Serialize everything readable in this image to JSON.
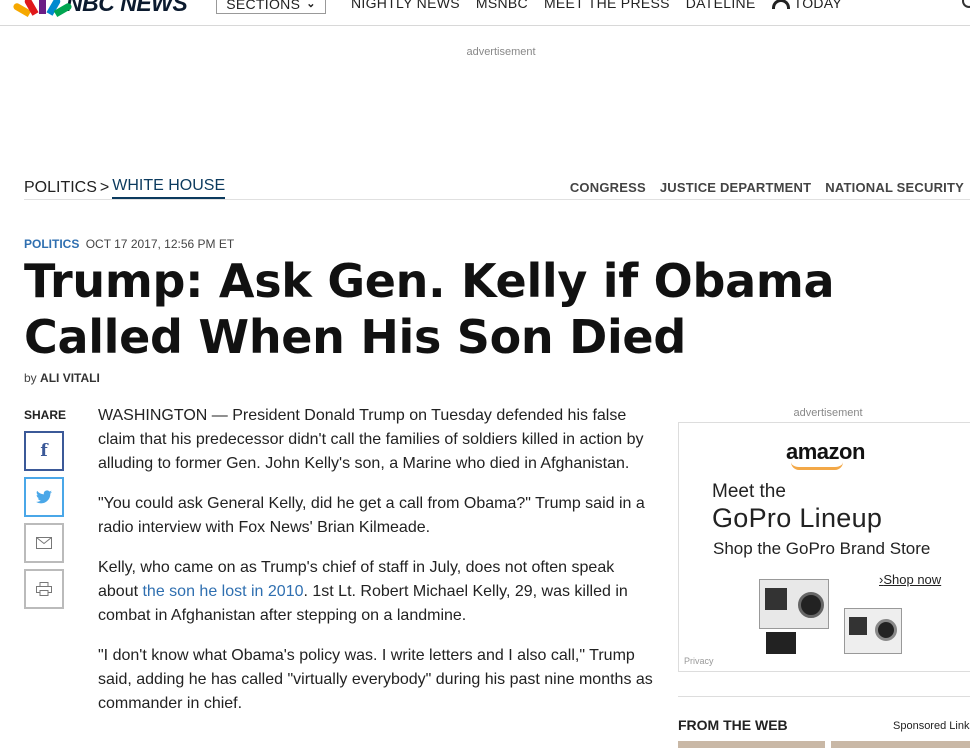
{
  "topnav": {
    "logo_text": "NBC NEWS",
    "sections_label": "SECTIONS",
    "links": [
      "NIGHTLY NEWS",
      "MSNBC",
      "MEET THE PRESS",
      "DATELINE"
    ],
    "today_label": "TODAY",
    "colors": {
      "peacock": [
        "#f6a800",
        "#e0181b",
        "#6b1d85",
        "#0089cf",
        "#00a651"
      ]
    }
  },
  "ads": {
    "top_label": "advertisement",
    "side_label": "advertisement",
    "brand": "amazon",
    "headline_small": "Meet the",
    "headline_large": "GoPro Lineup",
    "subline": "Shop the GoPro Brand Store",
    "cta": "Shop now",
    "privacy": "Privacy"
  },
  "section_nav": {
    "breadcrumb_parent": "POLITICS",
    "breadcrumb_sep": ">",
    "breadcrumb_current": "WHITE HOUSE",
    "subnav": [
      "CONGRESS",
      "JUSTICE DEPARTMENT",
      "NATIONAL SECURITY"
    ]
  },
  "article": {
    "category": "POLITICS",
    "datetime": "OCT 17 2017, 12:56 PM ET",
    "headline": "Trump: Ask Gen. Kelly if Obama Called When His Son Died",
    "byline_prefix": "by",
    "author": "ALI VITALI",
    "share_label": "SHARE",
    "paragraphs": {
      "p1": "WASHINGTON — President Donald Trump on Tuesday defended his false claim that his predecessor didn't call the families of soldiers killed in action by alluding to former Gen. John Kelly's son, a Marine who died in Afghanistan.",
      "p2": "\"You could ask General Kelly, did he get a call from Obama?\" Trump said in a radio interview with Fox News' Brian Kilmeade.",
      "p3_before": "Kelly, who came on as Trump's chief of staff in July, does not often speak about ",
      "p3_link": "the son he lost in 2010",
      "p3_after": ". 1st Lt. Robert Michael Kelly, 29, was killed in combat in Afghanistan after stepping on a landmine.",
      "p4": "\"I don't know what Obama's policy was. I write letters and I also call,\" Trump said, adding he has called \"virtually everybody\" during his past nine months as commander in chief."
    }
  },
  "sidebar": {
    "from_web": "FROM THE WEB",
    "sponsored": "Sponsored Links"
  }
}
